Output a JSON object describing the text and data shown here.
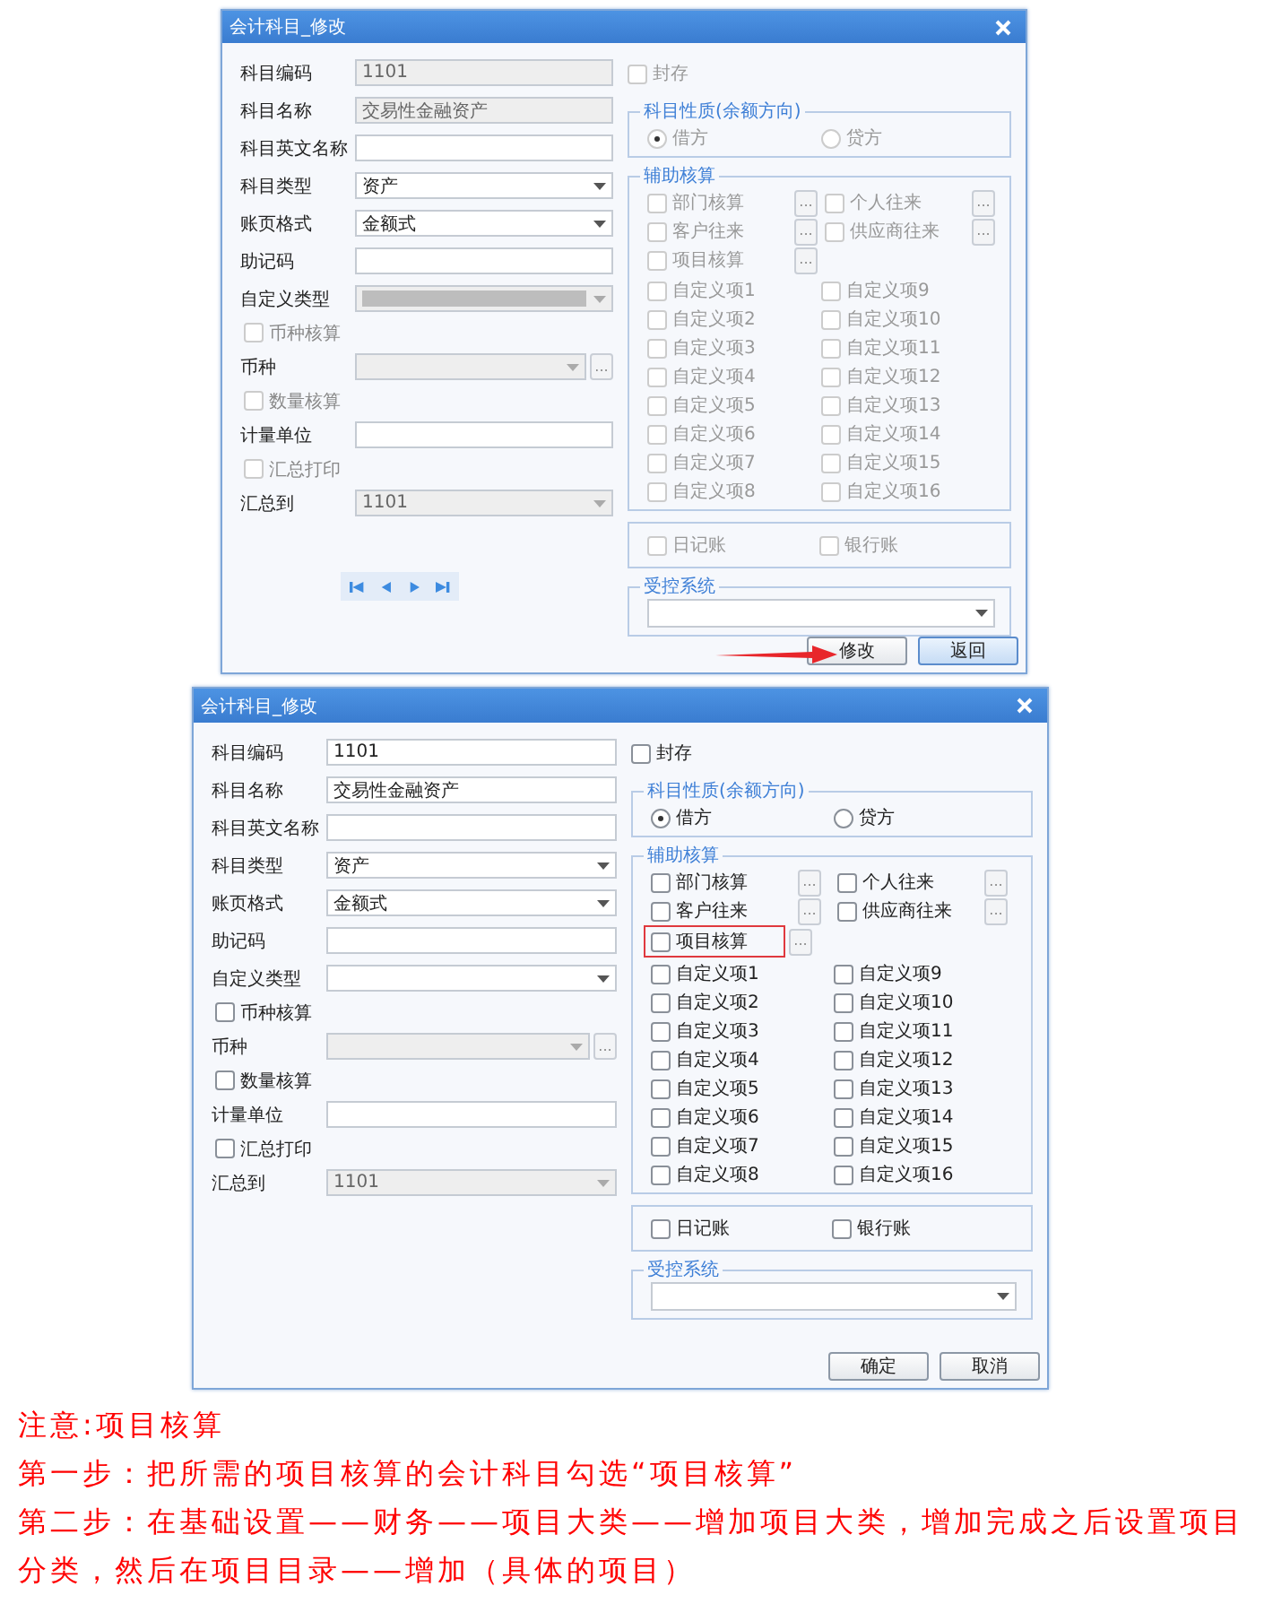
{
  "dialogs": [
    {
      "title": "会计科目_修改",
      "fields": [
        {
          "kind": "text",
          "label": "科目编码",
          "value": "1101",
          "disabled": true
        },
        {
          "kind": "text",
          "label": "科目名称",
          "value": "交易性金融资产",
          "disabled": true
        },
        {
          "kind": "text",
          "label": "科目英文名称",
          "disabled": false
        },
        {
          "kind": "select",
          "label": "科目类型",
          "value": "资产",
          "disabled": false
        },
        {
          "kind": "select",
          "label": "账页格式",
          "value": "金额式",
          "disabled": false
        },
        {
          "kind": "text",
          "label": "助记码",
          "disabled": false
        },
        {
          "kind": "select",
          "label": "自定义类型",
          "disabled": true
        },
        {
          "kind": "checkbox",
          "label": "币种核算",
          "checked": false,
          "disabled": true
        },
        {
          "kind": "select",
          "label": "币种",
          "disabled": true,
          "more_label": "..."
        },
        {
          "kind": "checkbox",
          "label": "数量核算",
          "checked": false,
          "disabled": true
        },
        {
          "kind": "text",
          "label": "计量单位",
          "disabled": false
        },
        {
          "kind": "checkbox",
          "label": "汇总打印",
          "checked": false,
          "disabled": true
        },
        {
          "kind": "select",
          "label": "汇总到",
          "value": "1101",
          "disabled": true
        }
      ],
      "sealed": {
        "label": "封存",
        "checked": false
      },
      "options_disabled": true,
      "balance": {
        "title": "科目性质(余额方向)",
        "options": [
          {
            "label": "借方",
            "selected": true
          },
          {
            "label": "贷方",
            "selected": false
          }
        ]
      },
      "auxiliary": {
        "title": "辅助核算",
        "items": [
          {
            "label": "部门核算",
            "checked": false,
            "highlighted": false,
            "more_label": "..."
          },
          {
            "label": "个人往来",
            "checked": false,
            "highlighted": false,
            "more_label": "..."
          },
          {
            "label": "客户往来",
            "checked": false,
            "highlighted": false,
            "more_label": "..."
          },
          {
            "label": "供应商往来",
            "checked": false,
            "highlighted": false,
            "more_label": "..."
          },
          {
            "label": "项目核算",
            "checked": false,
            "highlighted": false,
            "more_label": "..."
          }
        ],
        "custom_items": [
          {
            "label": "自定义项1",
            "checked": false
          },
          {
            "label": "自定义项2",
            "checked": false
          },
          {
            "label": "自定义项3",
            "checked": false
          },
          {
            "label": "自定义项4",
            "checked": false
          },
          {
            "label": "自定义项5",
            "checked": false
          },
          {
            "label": "自定义项6",
            "checked": false
          },
          {
            "label": "自定义项7",
            "checked": false
          },
          {
            "label": "自定义项8",
            "checked": false
          },
          {
            "label": "自定义项9",
            "checked": false
          },
          {
            "label": "自定义项10",
            "checked": false
          },
          {
            "label": "自定义项11",
            "checked": false
          },
          {
            "label": "自定义项12",
            "checked": false
          },
          {
            "label": "自定义项13",
            "checked": false
          },
          {
            "label": "自定义项14",
            "checked": false
          },
          {
            "label": "自定义项15",
            "checked": false
          },
          {
            "label": "自定义项16",
            "checked": false
          }
        ]
      },
      "ledgers": [
        {
          "label": "日记账",
          "checked": false
        },
        {
          "label": "银行账",
          "checked": false
        }
      ],
      "controlled_system": {
        "title": "受控系统"
      },
      "navigator": true,
      "arrow": true,
      "buttons": [
        {
          "label": "修改",
          "default": false
        },
        {
          "label": "返回",
          "default": true
        }
      ]
    },
    {
      "title": "会计科目_修改",
      "fields": [
        {
          "kind": "text",
          "label": "科目编码",
          "value": "1101",
          "disabled": false
        },
        {
          "kind": "text",
          "label": "科目名称",
          "value": "交易性金融资产",
          "disabled": false
        },
        {
          "kind": "text",
          "label": "科目英文名称",
          "disabled": false
        },
        {
          "kind": "select",
          "label": "科目类型",
          "value": "资产",
          "disabled": false
        },
        {
          "kind": "select",
          "label": "账页格式",
          "value": "金额式",
          "disabled": false
        },
        {
          "kind": "text",
          "label": "助记码",
          "disabled": false
        },
        {
          "kind": "select",
          "label": "自定义类型",
          "disabled": false
        },
        {
          "kind": "checkbox",
          "label": "币种核算",
          "checked": false,
          "disabled": false
        },
        {
          "kind": "select",
          "label": "币种",
          "disabled": true,
          "more_label": "..."
        },
        {
          "kind": "checkbox",
          "label": "数量核算",
          "checked": false,
          "disabled": false
        },
        {
          "kind": "text",
          "label": "计量单位",
          "disabled": false
        },
        {
          "kind": "checkbox",
          "label": "汇总打印",
          "checked": false,
          "disabled": false
        },
        {
          "kind": "select",
          "label": "汇总到",
          "value": "1101",
          "disabled": true
        }
      ],
      "sealed": {
        "label": "封存",
        "checked": false
      },
      "options_disabled": false,
      "balance": {
        "title": "科目性质(余额方向)",
        "options": [
          {
            "label": "借方",
            "selected": true
          },
          {
            "label": "贷方",
            "selected": false
          }
        ]
      },
      "auxiliary": {
        "title": "辅助核算",
        "items": [
          {
            "label": "部门核算",
            "checked": false,
            "highlighted": false,
            "more_label": "..."
          },
          {
            "label": "个人往来",
            "checked": false,
            "highlighted": false,
            "more_label": "..."
          },
          {
            "label": "客户往来",
            "checked": false,
            "highlighted": false,
            "more_label": "..."
          },
          {
            "label": "供应商往来",
            "checked": false,
            "highlighted": false,
            "more_label": "..."
          },
          {
            "label": "项目核算",
            "checked": false,
            "highlighted": true,
            "more_label": "..."
          }
        ],
        "custom_items": [
          {
            "label": "自定义项1",
            "checked": false
          },
          {
            "label": "自定义项2",
            "checked": false
          },
          {
            "label": "自定义项3",
            "checked": false
          },
          {
            "label": "自定义项4",
            "checked": false
          },
          {
            "label": "自定义项5",
            "checked": false
          },
          {
            "label": "自定义项6",
            "checked": false
          },
          {
            "label": "自定义项7",
            "checked": false
          },
          {
            "label": "自定义项8",
            "checked": false
          },
          {
            "label": "自定义项9",
            "checked": false
          },
          {
            "label": "自定义项10",
            "checked": false
          },
          {
            "label": "自定义项11",
            "checked": false
          },
          {
            "label": "自定义项12",
            "checked": false
          },
          {
            "label": "自定义项13",
            "checked": false
          },
          {
            "label": "自定义项14",
            "checked": false
          },
          {
            "label": "自定义项15",
            "checked": false
          },
          {
            "label": "自定义项16",
            "checked": false
          }
        ]
      },
      "ledgers": [
        {
          "label": "日记账",
          "checked": false
        },
        {
          "label": "银行账",
          "checked": false
        }
      ],
      "controlled_system": {
        "title": "受控系统"
      },
      "navigator": false,
      "arrow": false,
      "buttons": [
        {
          "label": "确定",
          "default": false
        },
        {
          "label": "取消",
          "default": false
        }
      ]
    }
  ],
  "notes": [
    "注意:项目核算",
    "第一步：把所需的项目核算的会计科目勾选“项目核算”",
    "第二步：在基础设置——财务——项目大类——增加项目大类，增加完成之后设置项目分类，然后在项目目录——增加（具体的项目）"
  ]
}
